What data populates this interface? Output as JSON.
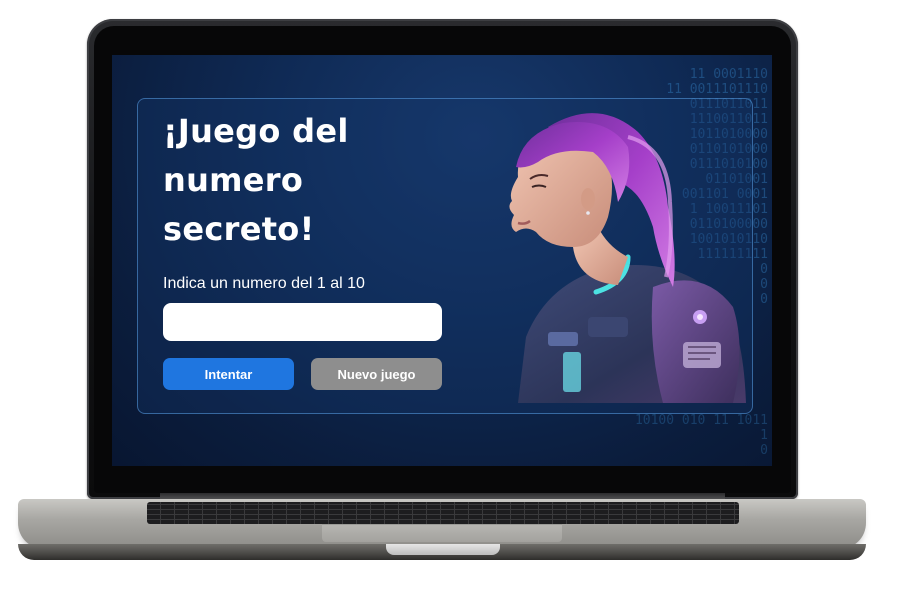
{
  "game": {
    "title": "¡Juego del numero secreto!",
    "prompt": "Indica un numero del 1 al 10",
    "input_value": "",
    "buttons": {
      "try_label": "Intentar",
      "new_game_label": "Nuevo juego"
    },
    "colors": {
      "try_button": "#1f76e0",
      "new_game_button": "#8e8e8e",
      "background": "#0f2a55"
    }
  },
  "decor": {
    "binary_top": "11 0001110\n11 0011101110\n0111011011\n1110011011\n1011010000\n0110101000\n0111010100\n01101001\n001101 0001\n1 10011101\n0110100000\n1001010110\n111111111\n0\n0\n0",
    "binary_bottom": "10100 010 11 1011\n1\n0"
  }
}
